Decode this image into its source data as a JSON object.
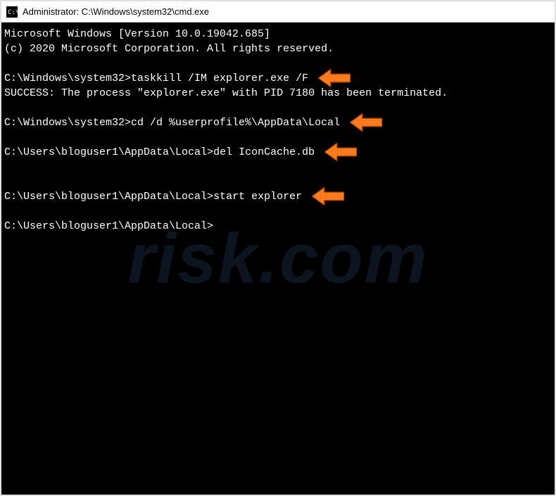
{
  "window": {
    "title": "Administrator: C:\\Windows\\system32\\cmd.exe"
  },
  "terminal": {
    "lines": [
      {
        "prompt": "",
        "command": "",
        "text": "Microsoft Windows [Version 10.0.19042.685]"
      },
      {
        "prompt": "",
        "command": "",
        "text": "(c) 2020 Microsoft Corporation. All rights reserved."
      },
      {
        "blank": true
      },
      {
        "prompt": "C:\\Windows\\system32>",
        "command": "taskkill /IM explorer.exe /F",
        "arrow": true
      },
      {
        "prompt": "",
        "command": "",
        "text": "SUCCESS: The process \"explorer.exe\" with PID 7180 has been terminated."
      },
      {
        "blank": true
      },
      {
        "prompt": "C:\\Windows\\system32>",
        "command": "cd /d %userprofile%\\AppData\\Local",
        "arrow": true
      },
      {
        "blank": true
      },
      {
        "prompt": "C:\\Users\\bloguser1\\AppData\\Local>",
        "command": "del IconCache.db",
        "arrow": true
      },
      {
        "blank": true
      },
      {
        "blank": true
      },
      {
        "prompt": "C:\\Users\\bloguser1\\AppData\\Local>",
        "command": "start explorer",
        "arrow": true
      },
      {
        "blank": true
      },
      {
        "prompt": "C:\\Users\\bloguser1\\AppData\\Local>",
        "command": ""
      }
    ]
  },
  "annotations": {
    "arrow_color_fill": "#ff7a1a",
    "arrow_color_stroke": "#8a2e00"
  },
  "watermark": {
    "text": "risk.com"
  }
}
